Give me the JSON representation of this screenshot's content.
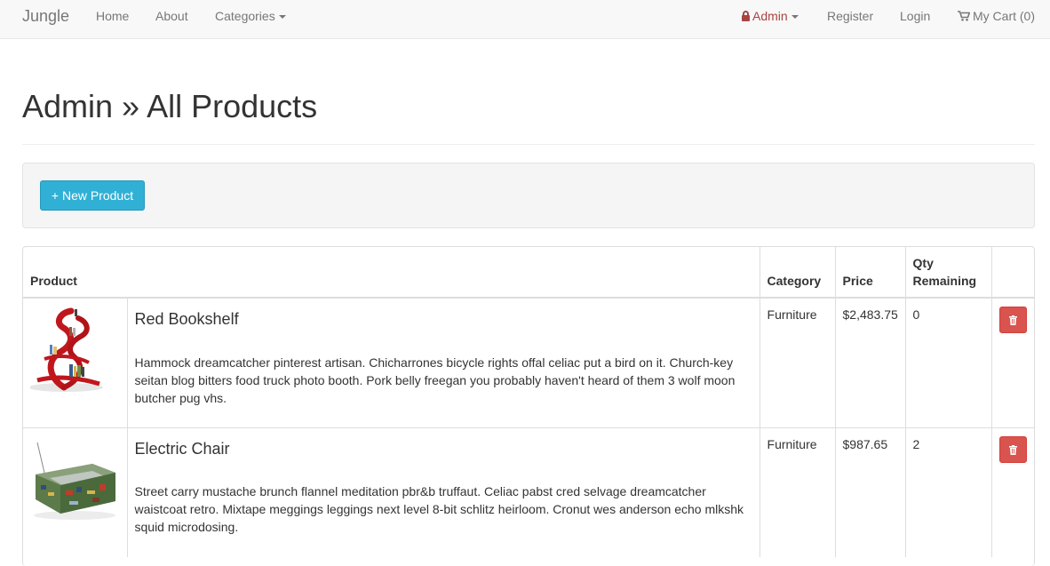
{
  "nav": {
    "brand": "Jungle",
    "home": "Home",
    "about": "About",
    "categories": "Categories",
    "admin": "Admin",
    "register": "Register",
    "login": "Login",
    "cart": "My Cart (0)"
  },
  "page": {
    "title": "Admin » All Products",
    "new_product_label": "+ New Product"
  },
  "table": {
    "headers": {
      "product": "Product",
      "category": "Category",
      "price": "Price",
      "qty": "Qty Remaining"
    },
    "rows": [
      {
        "image": "red-bookshelf-image",
        "name": "Red Bookshelf",
        "description": "Hammock dreamcatcher pinterest artisan. Chicharrones bicycle rights offal celiac put a bird on it. Church-key seitan blog bitters food truck photo booth. Pork belly freegan you probably haven't heard of them 3 wolf moon butcher pug vhs.",
        "category": "Furniture",
        "price": "$2,483.75",
        "qty": "0"
      },
      {
        "image": "electric-chair-image",
        "name": "Electric Chair",
        "description": "Street carry mustache brunch flannel meditation pbr&b truffaut. Celiac pabst cred selvage dreamcatcher waistcoat retro. Mixtape meggings leggings next level 8-bit schlitz heirloom. Cronut wes anderson echo mlkshk squid microdosing.",
        "category": "Furniture",
        "price": "$987.65",
        "qty": "2"
      }
    ]
  },
  "colors": {
    "navbar_bg": "#f8f8f8",
    "admin_red": "#a94442",
    "info_button": "#31b0d5",
    "danger_button": "#d9534f"
  }
}
